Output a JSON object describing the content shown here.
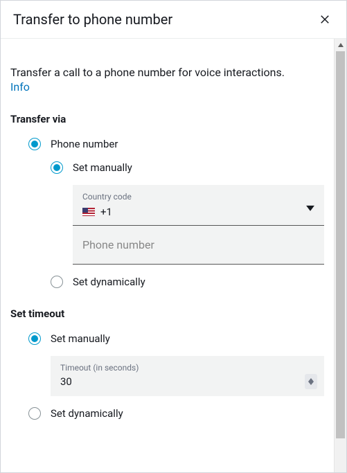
{
  "header": {
    "title": "Transfer to phone number"
  },
  "body": {
    "description": "Transfer a call to a phone number for voice interactions.",
    "info_link": "Info"
  },
  "transfer_via": {
    "heading": "Transfer via",
    "options": {
      "phone_number": "Phone number",
      "set_manually": "Set manually",
      "set_dynamically": "Set dynamically"
    },
    "country_code": {
      "label": "Country code",
      "value": "+1"
    },
    "phone_input": {
      "placeholder": "Phone number"
    }
  },
  "timeout": {
    "heading": "Set timeout",
    "options": {
      "set_manually": "Set manually",
      "set_dynamically": "Set dynamically"
    },
    "field": {
      "label": "Timeout (in seconds)",
      "value": "30"
    }
  }
}
